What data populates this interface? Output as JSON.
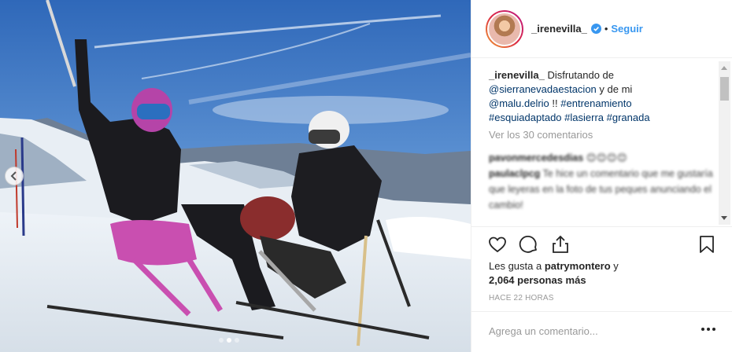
{
  "post": {
    "username": "_irenevilla_",
    "separator": "•",
    "follow_label": "Seguir",
    "caption": {
      "user": "_irenevilla_",
      "text_1": "Disfrutando de",
      "mention_1": "@sierranevadaestacion",
      "text_2": "y de mi",
      "mention_2": "@malu.delrio",
      "text_3": "!!",
      "hashtags": [
        "#entrenamiento",
        "#esquiadaptado",
        "#lasierra",
        "#granada"
      ]
    },
    "view_comments": "Ver los 30 comentarios",
    "blurred_comments": [
      {
        "user": "pavonmercedesdias",
        "text": "😊😊😊😊"
      },
      {
        "user": "paulaclpcg",
        "text": "Te hice un comentario que me gustaría que leyeras en la foto de tus peques anunciando el cambio!"
      }
    ],
    "likes": {
      "prefix": "Les gusta a",
      "user": "patrymontero",
      "conj": "y",
      "count_text": "2,064 personas más"
    },
    "timestamp": "HACE 22 HORAS",
    "add_comment_placeholder": "Agrega un comentario..."
  },
  "icons": {
    "verified": "verified-badge-icon",
    "like": "heart-icon",
    "comment": "comment-bubble-icon",
    "share": "share-icon",
    "save": "bookmark-icon",
    "prev": "chevron-left-icon",
    "more": "more-options-icon"
  },
  "colors": {
    "link": "#003569",
    "follow": "#3897f0",
    "verified": "#3897f0",
    "muted": "#999999"
  }
}
